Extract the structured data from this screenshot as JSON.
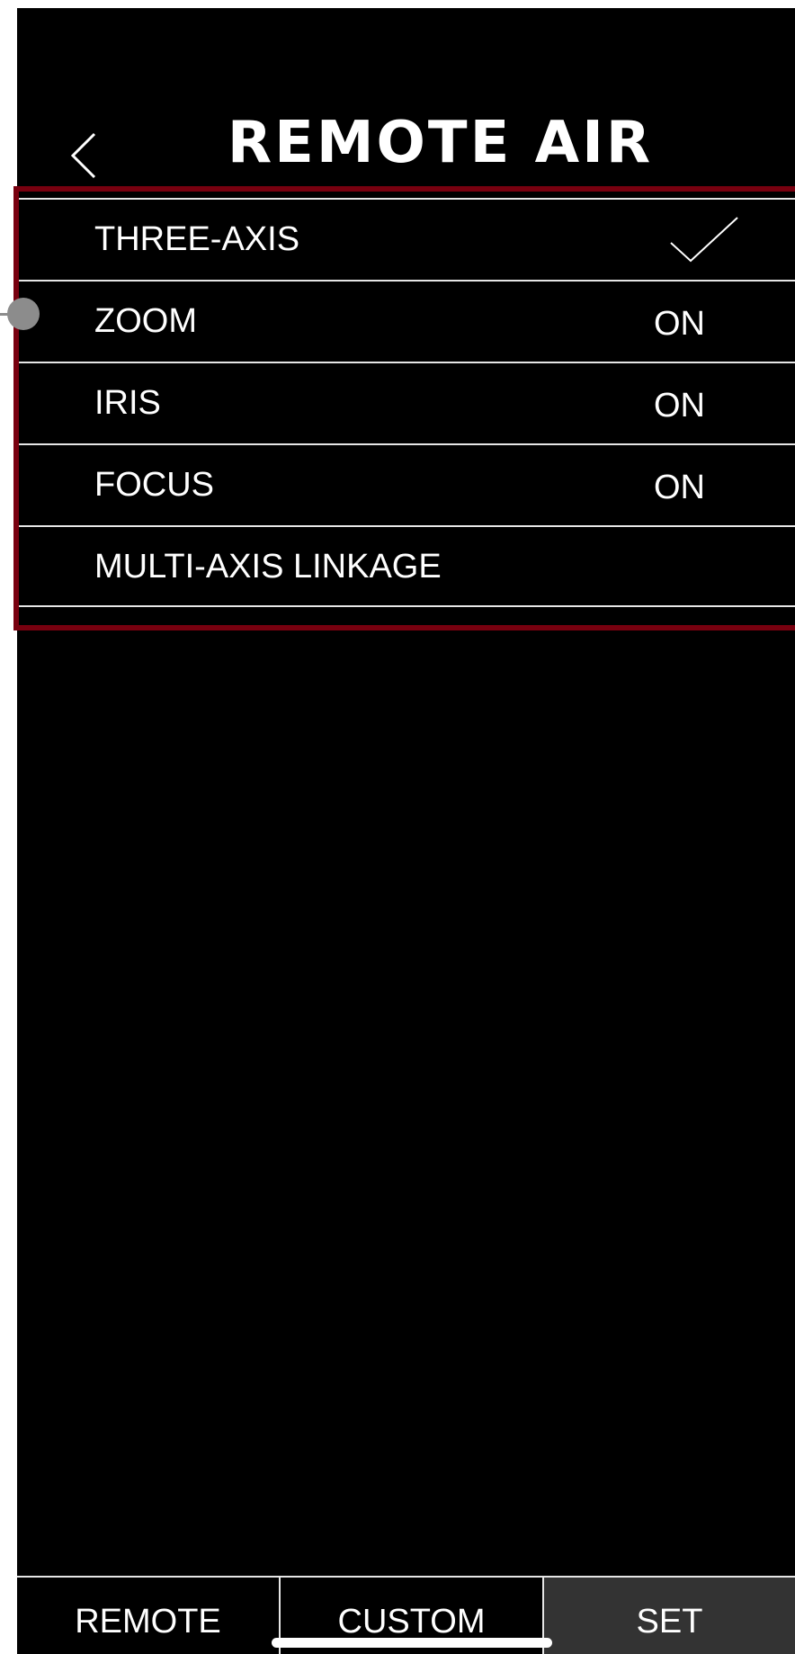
{
  "header": {
    "back_icon": "chevron-left-icon",
    "title": "REMOTE AIR"
  },
  "settings": {
    "items": [
      {
        "label": "THREE-AXIS",
        "value": "",
        "icon": "checkmark-icon",
        "selected": true
      },
      {
        "label": "ZOOM",
        "value": "ON"
      },
      {
        "label": "IRIS",
        "value": "ON"
      },
      {
        "label": "FOCUS",
        "value": "ON"
      },
      {
        "label": "MULTI-AXIS LINKAGE",
        "value": ""
      }
    ],
    "highlight_color": "#78000f"
  },
  "tab_bar": {
    "tabs": [
      {
        "label": "REMOTE"
      },
      {
        "label": "CUSTOM"
      },
      {
        "label": "SET",
        "active": true
      }
    ],
    "active_color": "#333333"
  },
  "colors": {
    "background": "#000000",
    "text": "#ffffff",
    "divider": "#e6e6e6"
  }
}
